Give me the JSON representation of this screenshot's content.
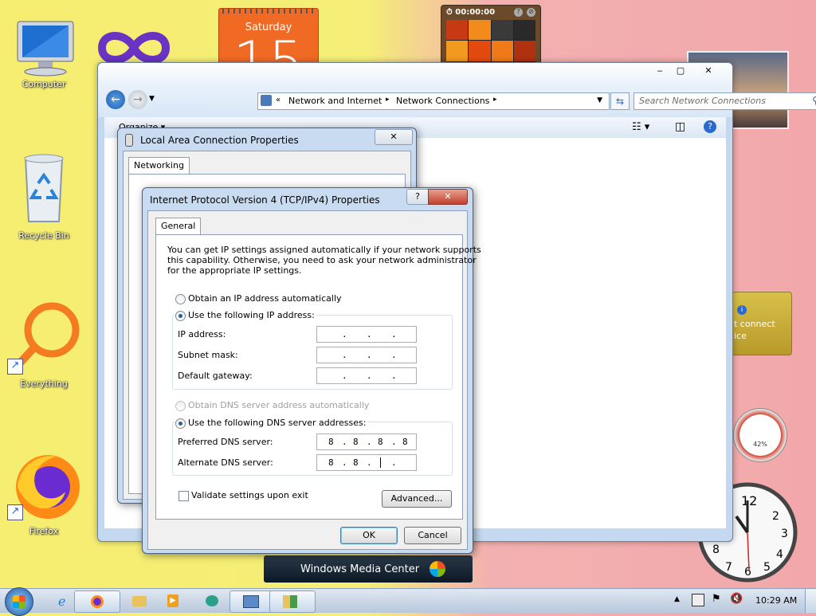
{
  "desktop": {
    "icons": [
      {
        "label": "Computer"
      },
      {
        "label": "Recycle Bin"
      },
      {
        "label": "Everything"
      },
      {
        "label": "Firefox"
      }
    ],
    "calendar": {
      "day_name": "Saturday",
      "day_number": "15"
    },
    "puzzle": {
      "timer": "00:00:00"
    },
    "media_center": {
      "label": "Windows Media Center"
    },
    "network_gadget": {
      "text_line1": "t connect",
      "text_line2": "ice"
    },
    "cpu_gadget": {
      "value": "42%"
    }
  },
  "explorer": {
    "breadcrumb": [
      "Network and Internet",
      "Network Connections"
    ],
    "search_placeholder": "Search Network Connections",
    "organize_label": "Organize"
  },
  "lac_dialog": {
    "title": "Local Area Connection Properties",
    "tab": "Networking"
  },
  "ipv4_dialog": {
    "title": "Internet Protocol Version 4 (TCP/IPv4) Properties",
    "tab": "General",
    "description": "You can get IP settings assigned automatically if your network supports this capability. Otherwise, you need to ask your network administrator for the appropriate IP settings.",
    "desc_line1": "You can get IP settings assigned automatically if your network supports",
    "desc_line2": "this capability. Otherwise, you need to ask your network administrator",
    "desc_line3": "for the appropriate IP settings.",
    "obtain_ip_auto": "Obtain an IP address automatically",
    "use_following_ip": "Use the following IP address:",
    "ip_address_label": "IP address:",
    "subnet_label": "Subnet mask:",
    "gateway_label": "Default gateway:",
    "obtain_dns_auto": "Obtain DNS server address automatically",
    "use_following_dns": "Use the following DNS server addresses:",
    "preferred_dns_label": "Preferred DNS server:",
    "alternate_dns_label": "Alternate DNS server:",
    "preferred_dns": [
      "8",
      "8",
      "8",
      "8"
    ],
    "alternate_dns": [
      "8",
      "8",
      "",
      ""
    ],
    "validate_label": "Validate settings upon exit",
    "advanced_label": "Advanced...",
    "ok_label": "OK",
    "cancel_label": "Cancel"
  },
  "taskbar": {
    "clock": "10:29 AM"
  }
}
